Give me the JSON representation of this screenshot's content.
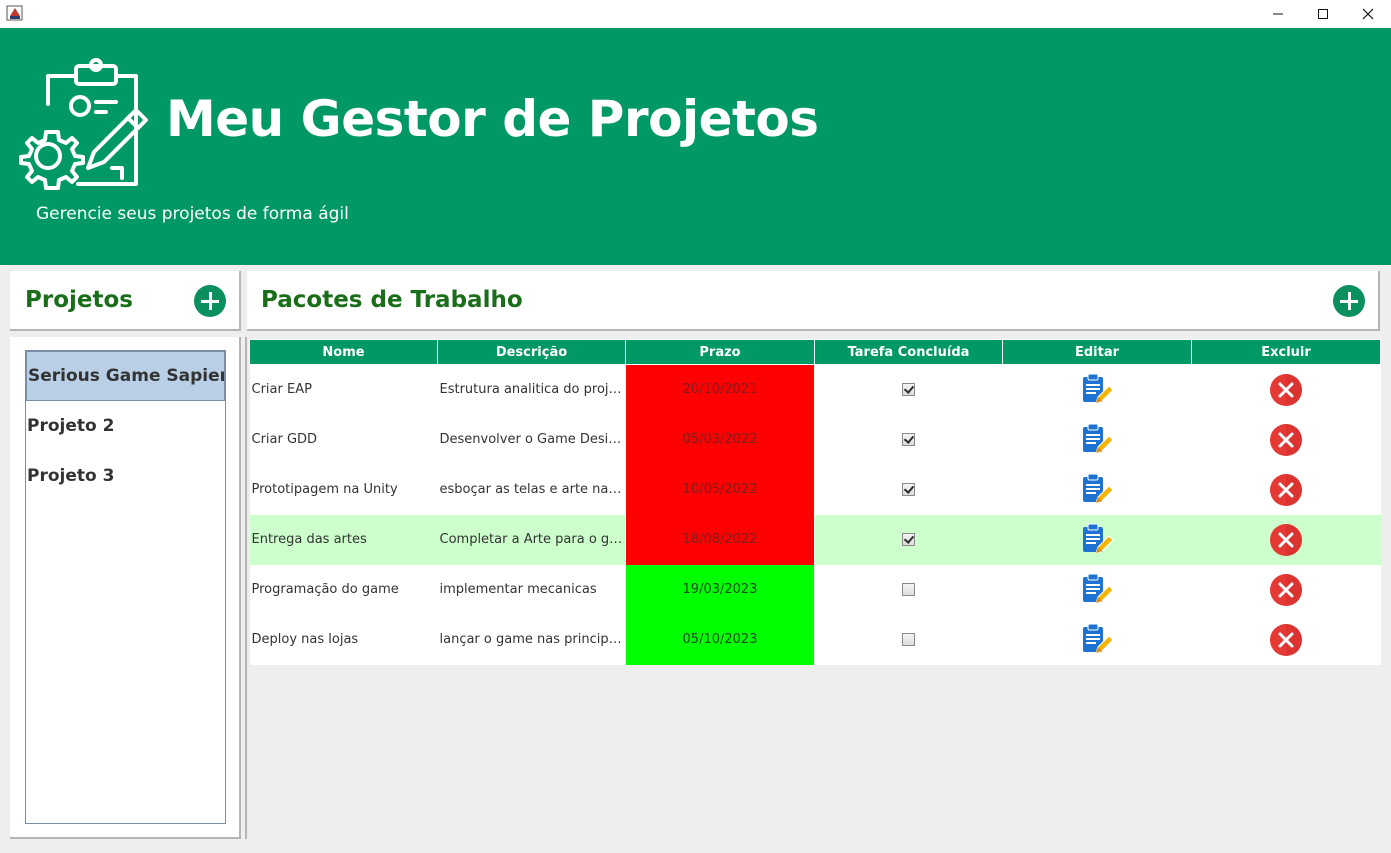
{
  "window": {
    "icons": {
      "app": "java-cup-icon",
      "minimize": "minimize-icon",
      "maximize": "maximize-icon",
      "close": "close-icon"
    }
  },
  "header": {
    "title": "Meu Gestor de Projetos",
    "subtitle": "Gerencie seus projetos de forma ágil",
    "logo_icon": "clipboard-gear-pencil-icon",
    "background": "#009966"
  },
  "projects_panel": {
    "title": "Projetos",
    "add_icon": "plus-circle-icon",
    "items": [
      {
        "label": "Serious Game Sapience",
        "selected": true
      },
      {
        "label": "Projeto 2",
        "selected": false
      },
      {
        "label": "Projeto 3",
        "selected": false
      }
    ]
  },
  "work_packages": {
    "title": "Pacotes de Trabalho",
    "add_icon": "plus-circle-icon",
    "columns": [
      "Nome",
      "Descrição",
      "Prazo",
      "Tarefa Concluída",
      "Editar",
      "Excluir"
    ],
    "rows": [
      {
        "name": "Criar EAP",
        "description": "Estrutura analitica do projeto",
        "deadline": "20/10/2021",
        "status": "late",
        "done": true,
        "highlighted": false
      },
      {
        "name": "Criar GDD",
        "description": "Desenvolver o Game Design Document",
        "deadline": "05/03/2022",
        "status": "late",
        "done": true,
        "highlighted": false
      },
      {
        "name": "Prototipagem na Unity",
        "description": "esboçar as telas e arte na unity",
        "deadline": "10/05/2022",
        "status": "late",
        "done": true,
        "highlighted": false
      },
      {
        "name": "Entrega das artes",
        "description": "Completar a Arte para o game",
        "deadline": "18/08/2022",
        "status": "late",
        "done": true,
        "highlighted": true
      },
      {
        "name": "Programação do game",
        "description": "implementar mecanicas",
        "deadline": "19/03/2023",
        "status": "ok",
        "done": false,
        "highlighted": false
      },
      {
        "name": "Deploy nas lojas",
        "description": "lançar o game nas principais lojas",
        "deadline": "05/10/2023",
        "status": "ok",
        "done": false,
        "highlighted": false
      }
    ],
    "edit_icon": "clipboard-edit-icon",
    "delete_icon": "delete-circle-icon",
    "colors": {
      "late": "#ff0000",
      "ok": "#00ff00",
      "highlight": "#ccffcc",
      "header": "#009966"
    }
  }
}
